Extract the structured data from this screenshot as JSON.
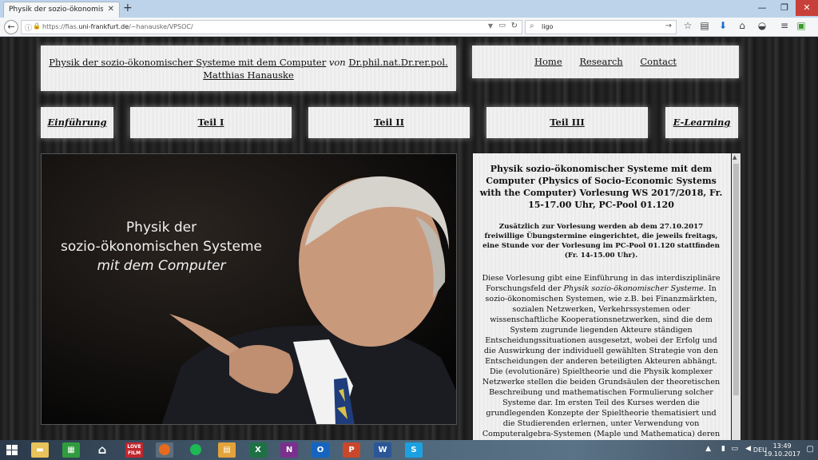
{
  "browser": {
    "tab_title": "Physik der sozio-ökonomische…",
    "tab_close": "✕",
    "new_tab": "+",
    "window_controls": [
      "—",
      "❐",
      "✕"
    ],
    "url_prefix": "https://fias.",
    "url_host": "uni-frankfurt.de",
    "url_path": "/~hanauske/VPSOC/",
    "search_value": "ligo"
  },
  "header": {
    "title_link": "Physik der sozio-ökonomischer Systeme mit dem Computer",
    "title_connector": "von",
    "author_line1": "Dr.phil.nat.Dr.rer.pol.",
    "author_line2": "Matthias Hanauske"
  },
  "nav": {
    "links": [
      "Home",
      "Research",
      "Contact"
    ]
  },
  "sections": [
    "Einführung",
    "Teil I",
    "Teil II",
    "Teil III",
    "E-Learning"
  ],
  "hero": {
    "caption_line1": "Physik der",
    "caption_line2": "sozio-ökonomischen Systeme",
    "caption_line3": "mit dem Computer"
  },
  "content": {
    "heading": "Physik sozio-ökonomischer Systeme mit dem Computer (Physics of Socio-Economic Systems with the Computer) Vorlesung WS 2017/2018, Fr. 15-17.00 Uhr, PC-Pool 01.120",
    "notice": "Zusätzlich zur Vorlesung werden ab dem 27.10.2017 freiwillige Übungstermine eingerichtet, die jeweils freitags, eine Stunde vor der Vorlesung im PC-Pool 01.120 stattfinden (Fr. 14-15.00 Uhr).",
    "body_before": "Diese Vorlesung gibt eine Einführung in das interdisziplinäre Forschungsfeld der ",
    "body_italic": "Physik sozio-ökonomischer Systeme",
    "body_after": ". In sozio-ökonomischen Systemen, wie z.B. bei Finanzmärkten, sozialen Netzwerken, Verkehrssystemen oder wissenschaftliche Kooperationsnetzwerken, sind die dem System zugrunde liegenden Akteure ständigen Entscheidungssituationen ausgesetzt, wobei der Erfolg und die Auswirkung der individuell gewählten Strategie von den Entscheidungen der anderen beteiligten Akteuren abhängt. Die (evolutionäre) Spieltheorie und die Physik komplexer Netzwerke stellen die beiden Grundsäulen der theoretischen Beschreibung und mathematischen Formulierung solcher Systeme dar. Im ersten Teil des Kurses werden die grundlegenden Konzepte der Spieltheorie thematisiert und die Studierenden erlernen, unter Verwendung von Computeralgebra-Systemen (Maple und Mathematica) deren Anwendung auf diverse Spielklassen. Neben den endlichen Zweipersonen-Spielen und N-Personen-Spielen wird auch auf die evolutionäre Entwicklung ganzer Spieler-Populationen eingegangen"
  },
  "taskbar": {
    "apps": [
      "file-explorer",
      "store",
      "home",
      "lovefilm",
      "firefox",
      "spotify",
      "notes",
      "excel",
      "onenote",
      "outlook",
      "powerpoint",
      "word",
      "skype"
    ],
    "lovefilm_label": "LOVE FILM",
    "language": "DEU",
    "time": "13:49",
    "date": "19.10.2017"
  },
  "colors": {
    "tabbar": "#bcd3ea",
    "accent_link": "#111111",
    "page_background": "#222222"
  }
}
